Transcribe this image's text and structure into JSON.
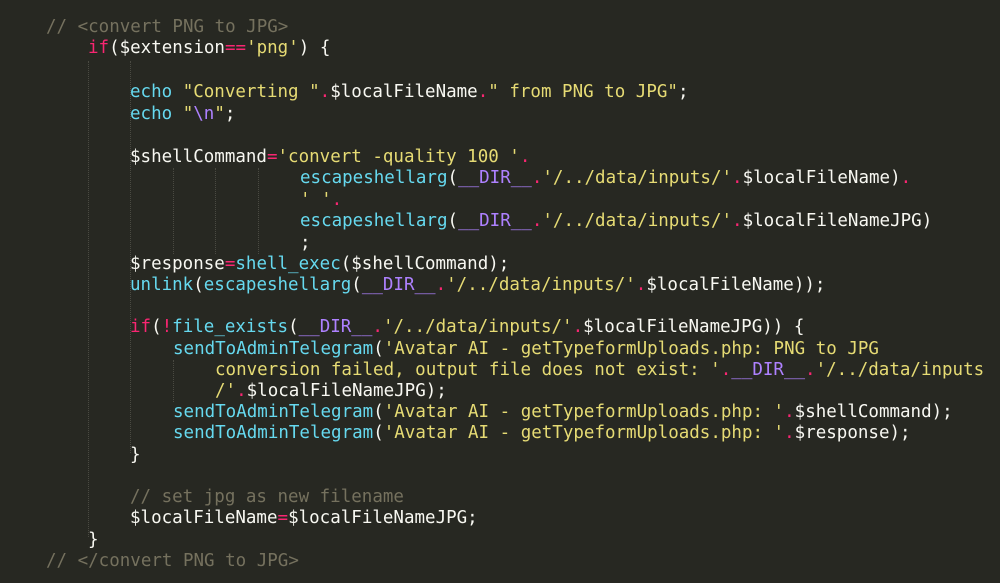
{
  "theme": {
    "background": "#272822",
    "colors": {
      "plain": "#f8f8f2",
      "comment": "#75715e",
      "keyword": "#f92672",
      "string": "#e6db74",
      "func": "#66d9ef",
      "const": "#ae81ff"
    }
  },
  "code_lines": [
    [
      [
        "comment",
        "// <convert PNG to JPG>"
      ]
    ],
    [
      [
        "keyword",
        "if"
      ],
      [
        "plain",
        "($extension"
      ],
      [
        "keyword",
        "=="
      ],
      [
        "string",
        "'png'"
      ],
      [
        "plain",
        ") {"
      ]
    ],
    [],
    [
      [
        "func",
        "echo"
      ],
      [
        "plain",
        " "
      ],
      [
        "string",
        "\"Converting \""
      ],
      [
        "keyword",
        "."
      ],
      [
        "plain",
        "$localFileName"
      ],
      [
        "keyword",
        "."
      ],
      [
        "string",
        "\" from PNG to JPG\""
      ],
      [
        "plain",
        ";"
      ]
    ],
    [
      [
        "func",
        "echo"
      ],
      [
        "plain",
        " "
      ],
      [
        "string",
        "\""
      ],
      [
        "const",
        "\\n"
      ],
      [
        "string",
        "\""
      ],
      [
        "plain",
        ";"
      ]
    ],
    [],
    [
      [
        "plain",
        "$shellCommand"
      ],
      [
        "keyword",
        "="
      ],
      [
        "string",
        "'convert -quality 100 '"
      ],
      [
        "keyword",
        "."
      ]
    ],
    [
      [
        "func",
        "escapeshellarg"
      ],
      [
        "plain",
        "("
      ],
      [
        "const",
        "__DIR__"
      ],
      [
        "keyword",
        "."
      ],
      [
        "string",
        "'/../data/inputs/'"
      ],
      [
        "keyword",
        "."
      ],
      [
        "plain",
        "$localFileName)"
      ],
      [
        "keyword",
        "."
      ]
    ],
    [
      [
        "string",
        "' '"
      ],
      [
        "keyword",
        "."
      ]
    ],
    [
      [
        "func",
        "escapeshellarg"
      ],
      [
        "plain",
        "("
      ],
      [
        "const",
        "__DIR__"
      ],
      [
        "keyword",
        "."
      ],
      [
        "string",
        "'/../data/inputs/'"
      ],
      [
        "keyword",
        "."
      ],
      [
        "plain",
        "$localFileNameJPG)"
      ]
    ],
    [
      [
        "plain",
        ";"
      ]
    ],
    [
      [
        "plain",
        "$response"
      ],
      [
        "keyword",
        "="
      ],
      [
        "func",
        "shell_exec"
      ],
      [
        "plain",
        "($shellCommand);"
      ]
    ],
    [
      [
        "func",
        "unlink"
      ],
      [
        "plain",
        "("
      ],
      [
        "func",
        "escapeshellarg"
      ],
      [
        "plain",
        "("
      ],
      [
        "const",
        "__DIR__"
      ],
      [
        "keyword",
        "."
      ],
      [
        "string",
        "'/../data/inputs/'"
      ],
      [
        "keyword",
        "."
      ],
      [
        "plain",
        "$localFileName));"
      ]
    ],
    [],
    [
      [
        "keyword",
        "if"
      ],
      [
        "plain",
        "("
      ],
      [
        "keyword",
        "!"
      ],
      [
        "func",
        "file_exists"
      ],
      [
        "plain",
        "("
      ],
      [
        "const",
        "__DIR__"
      ],
      [
        "keyword",
        "."
      ],
      [
        "string",
        "'/../data/inputs/'"
      ],
      [
        "keyword",
        "."
      ],
      [
        "plain",
        "$localFileNameJPG)) {"
      ]
    ],
    [
      [
        "func",
        "sendToAdminTelegram"
      ],
      [
        "plain",
        "("
      ],
      [
        "string",
        "'Avatar AI - getTypeformUploads.php: PNG to JPG"
      ]
    ],
    [
      [
        "string",
        "conversion failed, output file does not exist: '"
      ],
      [
        "keyword",
        "."
      ],
      [
        "const",
        "__DIR__"
      ],
      [
        "keyword",
        "."
      ],
      [
        "string",
        "'/../data/inputs"
      ]
    ],
    [
      [
        "string",
        "/'"
      ],
      [
        "keyword",
        "."
      ],
      [
        "plain",
        "$localFileNameJPG);"
      ]
    ],
    [
      [
        "func",
        "sendToAdminTelegram"
      ],
      [
        "plain",
        "("
      ],
      [
        "string",
        "'Avatar AI - getTypeformUploads.php: '"
      ],
      [
        "keyword",
        "."
      ],
      [
        "plain",
        "$shellCommand);"
      ]
    ],
    [
      [
        "func",
        "sendToAdminTelegram"
      ],
      [
        "plain",
        "("
      ],
      [
        "string",
        "'Avatar AI - getTypeformUploads.php: '"
      ],
      [
        "keyword",
        "."
      ],
      [
        "plain",
        "$response);"
      ]
    ],
    [
      [
        "plain",
        "}"
      ]
    ],
    [],
    [
      [
        "comment",
        "// set jpg as new filename"
      ]
    ],
    [
      [
        "plain",
        "$localFileName"
      ],
      [
        "keyword",
        "="
      ],
      [
        "plain",
        "$localFileNameJPG;"
      ]
    ],
    [
      [
        "plain",
        "}"
      ]
    ],
    [
      [
        "comment",
        "// </convert PNG to JPG>"
      ]
    ]
  ]
}
